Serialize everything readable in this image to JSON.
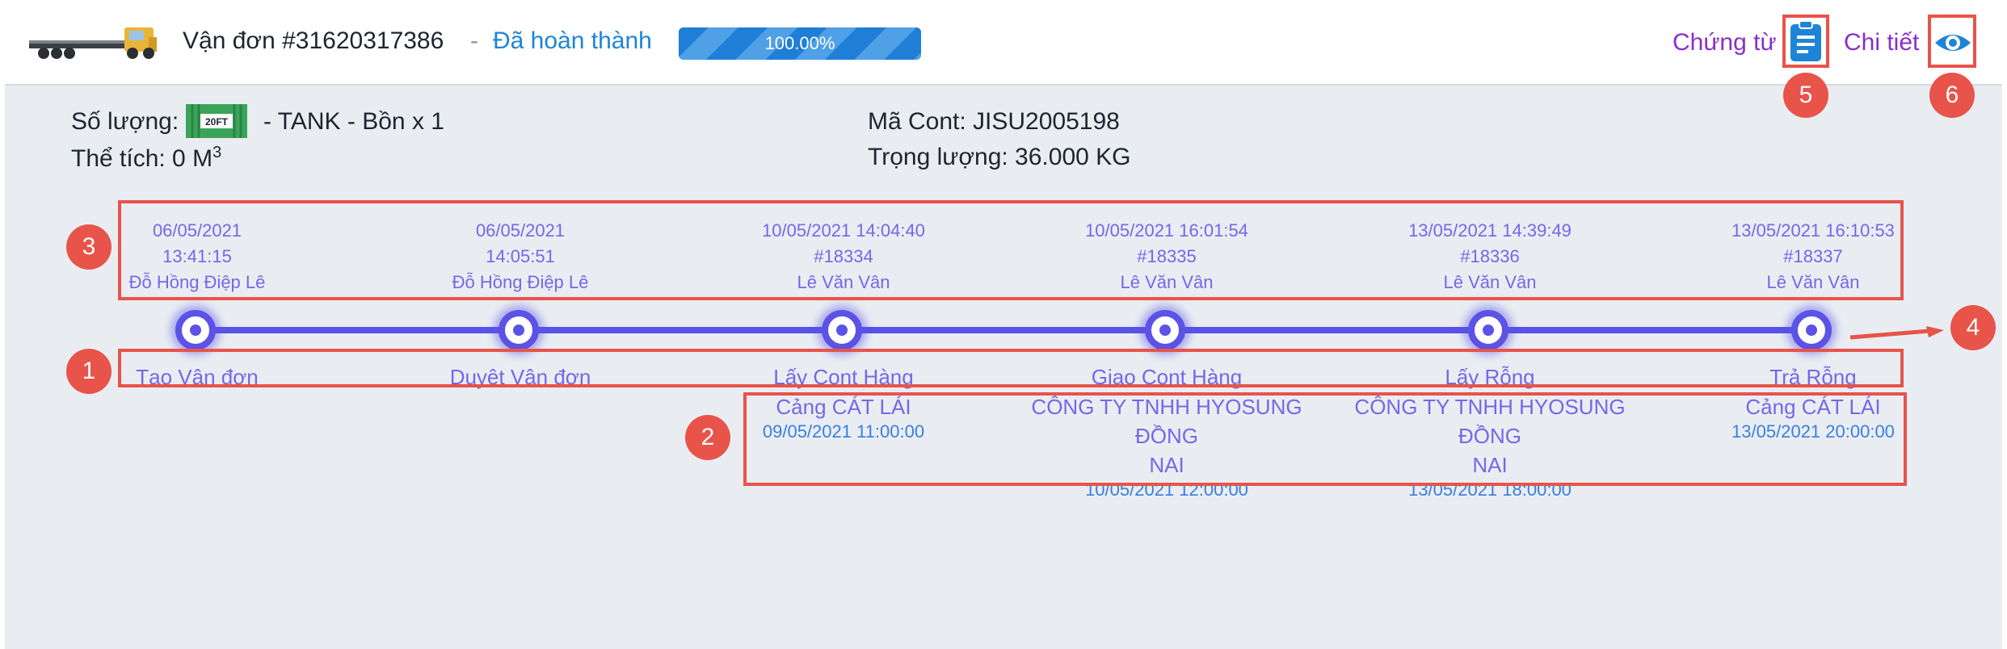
{
  "header": {
    "title": "Vận đơn #31620317386",
    "separator": "-",
    "status": "Đã hoàn thành",
    "progress_label": "100.00%",
    "progress_fraction": 1.0,
    "docs_label": "Chứng từ",
    "docs_icon": "clipboard-icon",
    "detail_label": "Chi tiết",
    "detail_icon": "eye-icon"
  },
  "info": {
    "quantity_label": "Số lượng:",
    "container_badge": "20FT",
    "quantity_value": "- TANK - Bồn x 1",
    "volume": "Thể tích: 0 M",
    "volume_unit_sup": "3",
    "cont_code": "Mã Cont: JISU2005198",
    "weight": "Trọng lượng: 36.000 KG"
  },
  "timeline": [
    {
      "date": "06/05/2021",
      "time": "13:41:15",
      "user": "Đỗ Hồng Điệp Lê",
      "label": "Tạo Vận đơn"
    },
    {
      "date": "06/05/2021",
      "time": "14:05:51",
      "user": "Đỗ Hồng Điệp Lê",
      "label": "Duyệt Vận đơn"
    },
    {
      "date": "10/05/2021 14:04:40",
      "time": "#18334",
      "user": "Lê Văn Vân",
      "label": "Lấy Cont Hàng",
      "location_line1": "Cảng CÁT LÁI",
      "location_line2": "",
      "location_time": "09/05/2021 11:00:00"
    },
    {
      "date": "10/05/2021 16:01:54",
      "time": "#18335",
      "user": "Lê Văn Vân",
      "label": "Giao Cont Hàng",
      "location_line1": "CÔNG TY TNHH HYOSUNG ĐỒNG",
      "location_line2": "NAI",
      "location_time": "10/05/2021 12:00:00"
    },
    {
      "date": "13/05/2021 14:39:49",
      "time": "#18336",
      "user": "Lê Văn Vân",
      "label": "Lấy Rỗng",
      "location_line1": "CÔNG TY TNHH HYOSUNG ĐỒNG",
      "location_line2": "NAI",
      "location_time": "13/05/2021 18:00:00"
    },
    {
      "date": "13/05/2021 16:10:53",
      "time": "#18337",
      "user": "Lê Văn Vân",
      "label": "Trả Rỗng",
      "location_line1": "Cảng CÁT LÁI",
      "location_line2": "",
      "location_time": "13/05/2021 20:00:00"
    }
  ],
  "annotations": {
    "badge1": "1",
    "badge2": "2",
    "badge3": "3",
    "badge4": "4",
    "badge5": "5",
    "badge6": "6"
  },
  "colors": {
    "accent_purple": "#5b52e6",
    "link_blue": "#1e84d8",
    "label_purple": "#8a2ec9",
    "annotation_red": "#e8534a"
  }
}
